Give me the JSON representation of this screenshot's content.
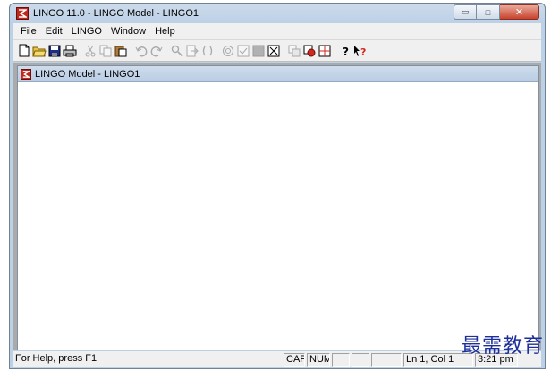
{
  "window": {
    "title": "LINGO 11.0 - LINGO Model - LINGO1",
    "minimize_glyph": "▭",
    "maximize_glyph": "□",
    "close_glyph": "✕"
  },
  "menu": {
    "items": [
      "File",
      "Edit",
      "LINGO",
      "Window",
      "Help"
    ]
  },
  "toolbar": {
    "icons": [
      "new-icon",
      "open-icon",
      "save-icon",
      "print-icon",
      "cut-icon",
      "copy-icon",
      "paste-icon",
      "undo-icon",
      "redo-icon",
      "find-icon",
      "goto-line-icon",
      "match-parenthesis-icon",
      "solve-icon",
      "solution-icon",
      "compile-icon",
      "close-all-icon",
      "options-icon",
      "send-to-back-icon",
      "tile-icon",
      "help-icon",
      "context-help-icon"
    ]
  },
  "child_window": {
    "title": "LINGO Model - LINGO1"
  },
  "statusbar": {
    "help_text": "For Help, press F1",
    "cap": "CAP",
    "num": "NUM",
    "position": "Ln 1, Col 1",
    "time": "3:21 pm"
  },
  "watermark": {
    "text": "最需教育"
  },
  "colors": {
    "app_icon_red": "#c0281e",
    "frame_blue": "#bcd0e6",
    "watermark_blue": "#1d2f9a"
  }
}
